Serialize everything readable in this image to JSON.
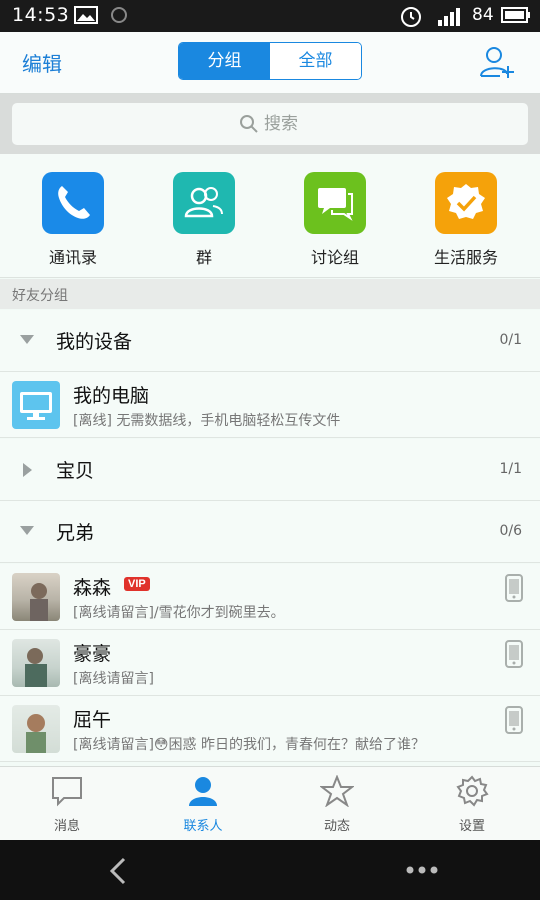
{
  "status_bar": {
    "time": "14:53",
    "battery": "84"
  },
  "header": {
    "edit_label": "编辑",
    "segments": [
      "分组",
      "全部"
    ],
    "add_icon": "add-friend-icon"
  },
  "search": {
    "placeholder": "搜索"
  },
  "apps": [
    {
      "label": "通讯录",
      "icon": "phone-icon",
      "color": "#1a8ae8"
    },
    {
      "label": "群",
      "icon": "group-icon",
      "color": "#1fb8b0"
    },
    {
      "label": "讨论组",
      "icon": "chat-icon",
      "color": "#6cc11e"
    },
    {
      "label": "生活服务",
      "icon": "badge-check-icon",
      "color": "#f5a20a"
    }
  ],
  "section_title": "好友分组",
  "groups": [
    {
      "name": "我的设备",
      "count": "0/1"
    },
    {
      "name": "宝贝",
      "count": "1/1"
    },
    {
      "name": "兄弟",
      "count": "0/6"
    }
  ],
  "device": {
    "name": "我的电脑",
    "sub": "[离线] 无需数据线，手机电脑轻松互传文件"
  },
  "contacts": [
    {
      "name": "森森",
      "badge": "VIP",
      "sub": "[离线请留言]/雪花你才到碗里去。"
    },
    {
      "name": "豪豪",
      "sub": "[离线请留言]"
    },
    {
      "name": "屈午",
      "sub": "[离线请留言]😳困惑 昨日的我们，青春何在？献给了谁？"
    }
  ],
  "tabs": [
    {
      "label": "消息",
      "icon": "message-icon"
    },
    {
      "label": "联系人",
      "icon": "contacts-icon"
    },
    {
      "label": "动态",
      "icon": "star-icon"
    },
    {
      "label": "设置",
      "icon": "settings-icon"
    }
  ]
}
